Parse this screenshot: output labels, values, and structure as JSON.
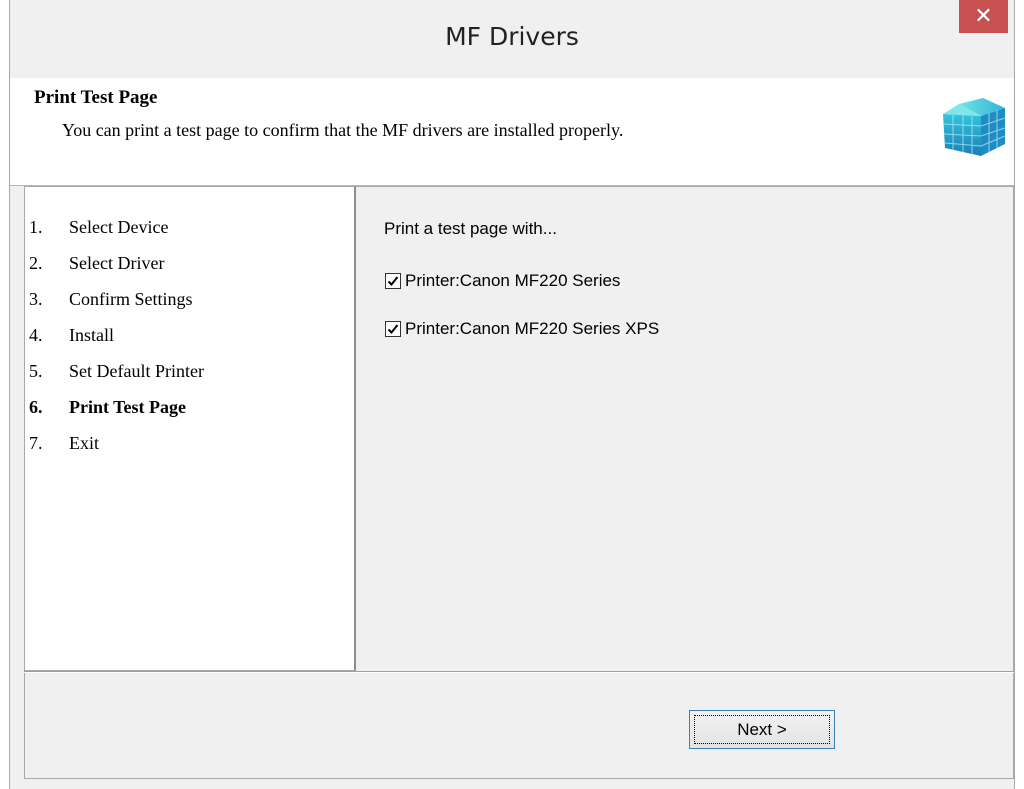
{
  "window": {
    "title": "MF Drivers",
    "close_label": "✕"
  },
  "header": {
    "title": "Print Test Page",
    "description": "You can print a test page to confirm that the MF drivers are installed properly."
  },
  "steps": [
    {
      "num": "1.",
      "label": "Select Device",
      "active": false
    },
    {
      "num": "2.",
      "label": "Select Driver",
      "active": false
    },
    {
      "num": "3.",
      "label": "Confirm Settings",
      "active": false
    },
    {
      "num": "4.",
      "label": "Install",
      "active": false
    },
    {
      "num": "5.",
      "label": "Set Default Printer",
      "active": false
    },
    {
      "num": "6.",
      "label": "Print Test Page",
      "active": true
    },
    {
      "num": "7.",
      "label": "Exit",
      "active": false
    }
  ],
  "main": {
    "prompt": "Print a test page with...",
    "printers": [
      {
        "label": "Printer:Canon MF220 Series",
        "checked": true
      },
      {
        "label": "Printer:Canon MF220 Series XPS",
        "checked": true
      }
    ]
  },
  "footer": {
    "next_label": "Next >"
  },
  "colors": {
    "close_button": "#c75050",
    "focus_border": "#3c7fb1"
  }
}
